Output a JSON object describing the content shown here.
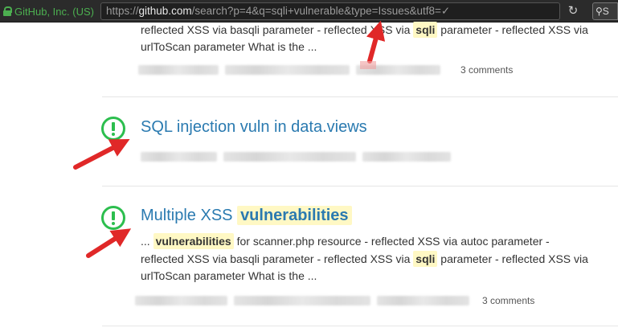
{
  "browser": {
    "identity": "GitHub, Inc. (US)",
    "url_prefix": "https://",
    "url_host": "github.com",
    "url_path": "/search?p=4&q=sqli+vulnerable&type=Issues&utf8=✓",
    "reload_icon": "↻",
    "search_ext_label": "S"
  },
  "results": [
    {
      "snippet_line1": "reflected XSS via basqli parameter - reflected XSS via",
      "snippet_hl": "sqli",
      "snippet_tail": "parameter - reflected XSS via",
      "snippet_line2": "urlToScan parameter What is the ...",
      "comments": "3 comments"
    },
    {
      "title": "SQL injection vuln in data.views"
    },
    {
      "title_plain": "Multiple XSS",
      "title_hl": "vulnerabilities",
      "snippet_prefix": "...",
      "snippet_hl1": "vulnerabilities",
      "snippet_line1_rest": "for scanner.php resource - reflected XSS via autoc parameter -",
      "snippet_line2_start": "reflected XSS via basqli parameter - reflected XSS via",
      "snippet_hl2": "sqli",
      "snippet_line2_rest": "parameter - reflected XSS via",
      "snippet_line3": "urlToScan parameter What is the ...",
      "comments": "3 comments"
    }
  ],
  "colors": {
    "issue_open": "#2cbe4e",
    "link": "#2a7ab0",
    "highlight": "#fff8c4",
    "annotation_arrow": "#e02828"
  }
}
